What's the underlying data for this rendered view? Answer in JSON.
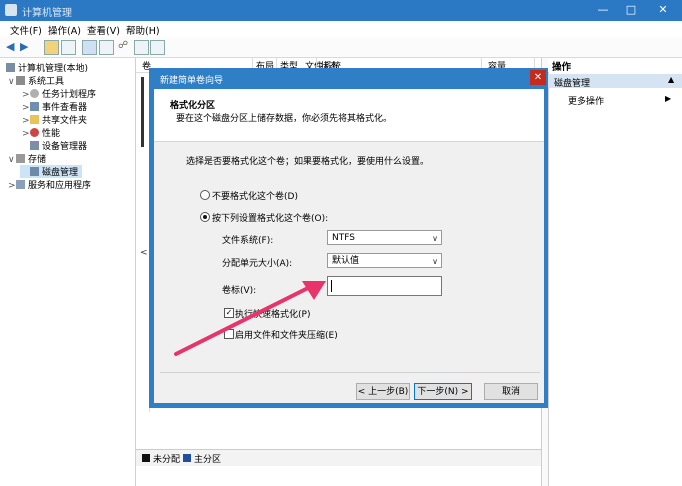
{
  "window": {
    "title": "计算机管理"
  },
  "menu": [
    "文件(F)",
    "操作(A)",
    "查看(V)",
    "帮助(H)"
  ],
  "tree": [
    {
      "label": "计算机管理(本地)",
      "indent": 0
    },
    {
      "label": "系统工具",
      "indent": 1
    },
    {
      "label": "任务计划程序",
      "indent": 2
    },
    {
      "label": "事件查看器",
      "indent": 2
    },
    {
      "label": "共享文件夹",
      "indent": 2
    },
    {
      "label": "性能",
      "indent": 2
    },
    {
      "label": "设备管理器",
      "indent": 2
    },
    {
      "label": "存储",
      "indent": 1
    },
    {
      "label": "磁盘管理",
      "indent": 2
    },
    {
      "label": "服务和应用程序",
      "indent": 1
    }
  ],
  "columns": [
    "卷",
    "布局",
    "类型",
    "文件系统",
    "状态",
    "容量"
  ],
  "legend": {
    "unallocated": "未分配",
    "primary": "主分区"
  },
  "actions": {
    "title": "操作",
    "section": "磁盘管理",
    "more": "更多操作"
  },
  "dialog": {
    "title": "新建简单卷向导",
    "header": "格式化分区",
    "subheader": "要在这个磁盘分区上储存数据，你必须先将其格式化。",
    "prompt": "选择是否要格式化这个卷；如果要格式化，要使用什么设置。",
    "radio_no": "不要格式化这个卷(D)",
    "radio_yes": "按下列设置格式化这个卷(O):",
    "fs_label": "文件系统(F):",
    "fs_value": "NTFS",
    "alloc_label": "分配单元大小(A):",
    "alloc_value": "默认值",
    "vol_label": "卷标(V):",
    "vol_value": "",
    "quick_format": "执行快速格式化(P)",
    "compression": "启用文件和文件夹压缩(E)",
    "back": "< 上一步(B)",
    "next": "下一步(N) >",
    "cancel": "取消"
  },
  "colors": {
    "titlebar": "#2b79c5",
    "dialog_frame": "#2f7fc6",
    "arrow": "#e8336b",
    "close": "#c42b1c"
  }
}
